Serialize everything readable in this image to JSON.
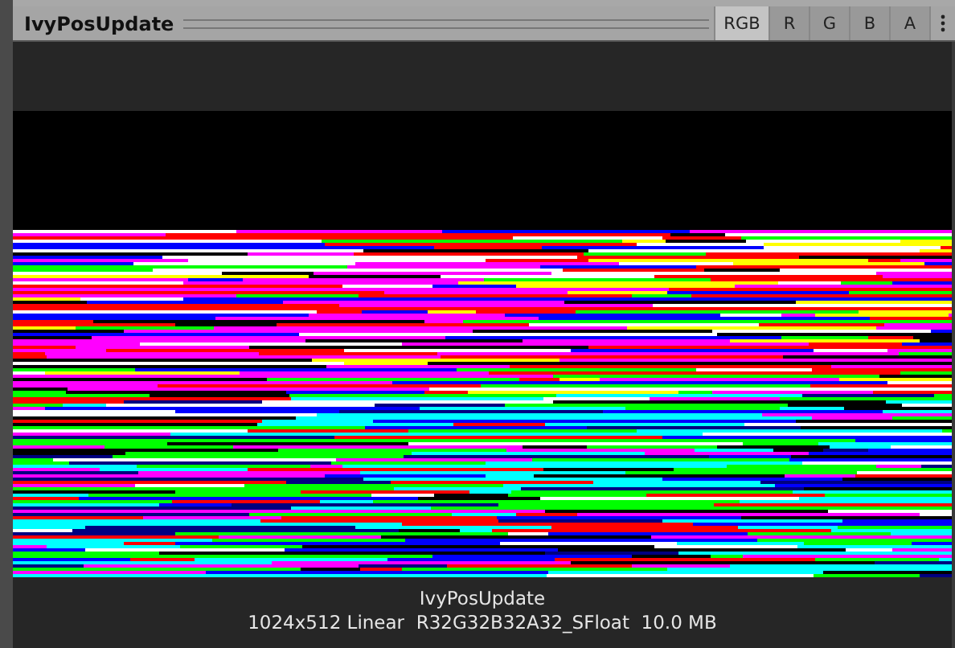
{
  "header": {
    "title": "IvyPosUpdate"
  },
  "channels": [
    {
      "label": "RGB",
      "selected": true
    },
    {
      "label": "R",
      "selected": false
    },
    {
      "label": "G",
      "selected": false
    },
    {
      "label": "B",
      "selected": false
    },
    {
      "label": "A",
      "selected": false
    }
  ],
  "preview": {
    "name": "IvyPosUpdate",
    "info": "1024x512 Linear  R32G32B32A32_SFloat  10.0 MB"
  }
}
